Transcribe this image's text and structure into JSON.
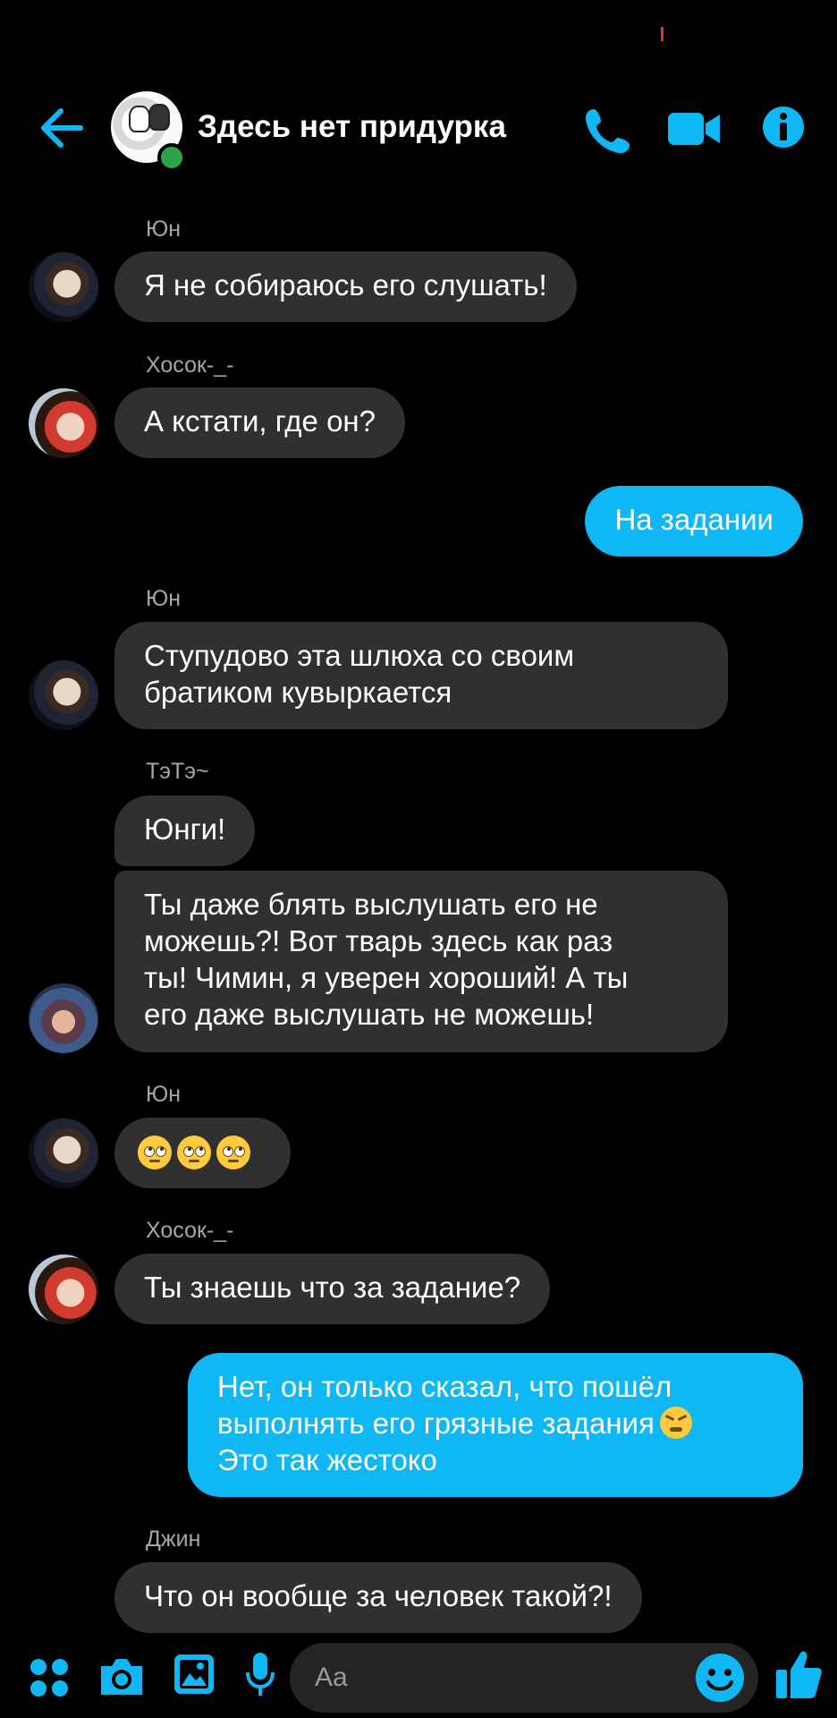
{
  "header": {
    "title": "Здесь нет придурка",
    "icons": [
      "back-arrow-icon",
      "phone-icon",
      "video-camera-icon",
      "info-icon"
    ],
    "accent": "#0fb8f5"
  },
  "messages": [
    {
      "sender": "Юн",
      "text": "Я не собираюсь его слушать!"
    },
    {
      "sender": "Хосок-_-",
      "text": "А кстати, где он?"
    },
    {
      "outgoing": true,
      "text": "На задании"
    },
    {
      "sender": "Юн",
      "lines": [
        "Ступудово эта шлюха со своим",
        "братиком кувыркается"
      ]
    },
    {
      "sender": "ТэТэ~",
      "text": "Юнги!"
    },
    {
      "lines": [
        "Ты даже блять выслушать его не",
        "можешь?! Вот тварь здесь как раз",
        "ты! Чимин, я уверен хороший! А ты",
        "его даже выслушать не можешь!"
      ]
    },
    {
      "sender": "Юн",
      "emoji": [
        "face-with-rolling-eyes",
        "face-with-rolling-eyes",
        "face-with-rolling-eyes"
      ]
    },
    {
      "sender": "Хосок-_-",
      "text": "Ты знаешь что за задание?"
    },
    {
      "outgoing": true,
      "lines": [
        "Нет, он только сказал, что пошёл",
        "выполнять его грязные задания",
        "Это так жестоко"
      ],
      "emoji": "persevering-face"
    },
    {
      "sender": "Джин",
      "text": "Что он вообще за человек такой?!"
    }
  ],
  "composer": {
    "placeholder": "Aa",
    "icons": [
      "menu-dots-icon",
      "camera-icon",
      "gallery-icon",
      "microphone-icon",
      "emoji-icon",
      "like-icon"
    ]
  },
  "colors": {
    "background": "#000000",
    "incoming_bubble": "#303030",
    "outgoing_bubble": "#0fb8f5",
    "sender_label": "#a6a6a6",
    "online": "#31a24c"
  }
}
